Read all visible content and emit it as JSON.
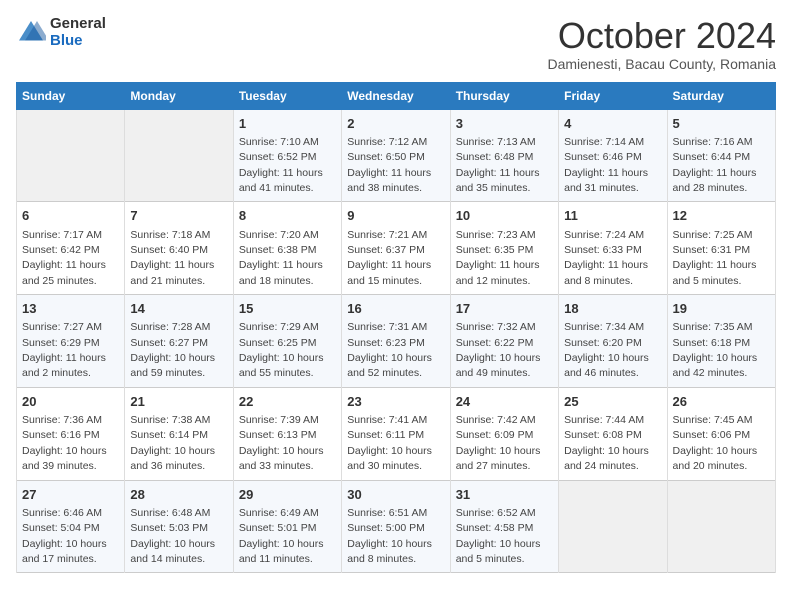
{
  "logo": {
    "general": "General",
    "blue": "Blue"
  },
  "title": "October 2024",
  "location": "Damienesti, Bacau County, Romania",
  "days_header": [
    "Sunday",
    "Monday",
    "Tuesday",
    "Wednesday",
    "Thursday",
    "Friday",
    "Saturday"
  ],
  "weeks": [
    [
      {
        "day": "",
        "info": ""
      },
      {
        "day": "",
        "info": ""
      },
      {
        "day": "1",
        "info": "Sunrise: 7:10 AM\nSunset: 6:52 PM\nDaylight: 11 hours and 41 minutes."
      },
      {
        "day": "2",
        "info": "Sunrise: 7:12 AM\nSunset: 6:50 PM\nDaylight: 11 hours and 38 minutes."
      },
      {
        "day": "3",
        "info": "Sunrise: 7:13 AM\nSunset: 6:48 PM\nDaylight: 11 hours and 35 minutes."
      },
      {
        "day": "4",
        "info": "Sunrise: 7:14 AM\nSunset: 6:46 PM\nDaylight: 11 hours and 31 minutes."
      },
      {
        "day": "5",
        "info": "Sunrise: 7:16 AM\nSunset: 6:44 PM\nDaylight: 11 hours and 28 minutes."
      }
    ],
    [
      {
        "day": "6",
        "info": "Sunrise: 7:17 AM\nSunset: 6:42 PM\nDaylight: 11 hours and 25 minutes."
      },
      {
        "day": "7",
        "info": "Sunrise: 7:18 AM\nSunset: 6:40 PM\nDaylight: 11 hours and 21 minutes."
      },
      {
        "day": "8",
        "info": "Sunrise: 7:20 AM\nSunset: 6:38 PM\nDaylight: 11 hours and 18 minutes."
      },
      {
        "day": "9",
        "info": "Sunrise: 7:21 AM\nSunset: 6:37 PM\nDaylight: 11 hours and 15 minutes."
      },
      {
        "day": "10",
        "info": "Sunrise: 7:23 AM\nSunset: 6:35 PM\nDaylight: 11 hours and 12 minutes."
      },
      {
        "day": "11",
        "info": "Sunrise: 7:24 AM\nSunset: 6:33 PM\nDaylight: 11 hours and 8 minutes."
      },
      {
        "day": "12",
        "info": "Sunrise: 7:25 AM\nSunset: 6:31 PM\nDaylight: 11 hours and 5 minutes."
      }
    ],
    [
      {
        "day": "13",
        "info": "Sunrise: 7:27 AM\nSunset: 6:29 PM\nDaylight: 11 hours and 2 minutes."
      },
      {
        "day": "14",
        "info": "Sunrise: 7:28 AM\nSunset: 6:27 PM\nDaylight: 10 hours and 59 minutes."
      },
      {
        "day": "15",
        "info": "Sunrise: 7:29 AM\nSunset: 6:25 PM\nDaylight: 10 hours and 55 minutes."
      },
      {
        "day": "16",
        "info": "Sunrise: 7:31 AM\nSunset: 6:23 PM\nDaylight: 10 hours and 52 minutes."
      },
      {
        "day": "17",
        "info": "Sunrise: 7:32 AM\nSunset: 6:22 PM\nDaylight: 10 hours and 49 minutes."
      },
      {
        "day": "18",
        "info": "Sunrise: 7:34 AM\nSunset: 6:20 PM\nDaylight: 10 hours and 46 minutes."
      },
      {
        "day": "19",
        "info": "Sunrise: 7:35 AM\nSunset: 6:18 PM\nDaylight: 10 hours and 42 minutes."
      }
    ],
    [
      {
        "day": "20",
        "info": "Sunrise: 7:36 AM\nSunset: 6:16 PM\nDaylight: 10 hours and 39 minutes."
      },
      {
        "day": "21",
        "info": "Sunrise: 7:38 AM\nSunset: 6:14 PM\nDaylight: 10 hours and 36 minutes."
      },
      {
        "day": "22",
        "info": "Sunrise: 7:39 AM\nSunset: 6:13 PM\nDaylight: 10 hours and 33 minutes."
      },
      {
        "day": "23",
        "info": "Sunrise: 7:41 AM\nSunset: 6:11 PM\nDaylight: 10 hours and 30 minutes."
      },
      {
        "day": "24",
        "info": "Sunrise: 7:42 AM\nSunset: 6:09 PM\nDaylight: 10 hours and 27 minutes."
      },
      {
        "day": "25",
        "info": "Sunrise: 7:44 AM\nSunset: 6:08 PM\nDaylight: 10 hours and 24 minutes."
      },
      {
        "day": "26",
        "info": "Sunrise: 7:45 AM\nSunset: 6:06 PM\nDaylight: 10 hours and 20 minutes."
      }
    ],
    [
      {
        "day": "27",
        "info": "Sunrise: 6:46 AM\nSunset: 5:04 PM\nDaylight: 10 hours and 17 minutes."
      },
      {
        "day": "28",
        "info": "Sunrise: 6:48 AM\nSunset: 5:03 PM\nDaylight: 10 hours and 14 minutes."
      },
      {
        "day": "29",
        "info": "Sunrise: 6:49 AM\nSunset: 5:01 PM\nDaylight: 10 hours and 11 minutes."
      },
      {
        "day": "30",
        "info": "Sunrise: 6:51 AM\nSunset: 5:00 PM\nDaylight: 10 hours and 8 minutes."
      },
      {
        "day": "31",
        "info": "Sunrise: 6:52 AM\nSunset: 4:58 PM\nDaylight: 10 hours and 5 minutes."
      },
      {
        "day": "",
        "info": ""
      },
      {
        "day": "",
        "info": ""
      }
    ]
  ]
}
